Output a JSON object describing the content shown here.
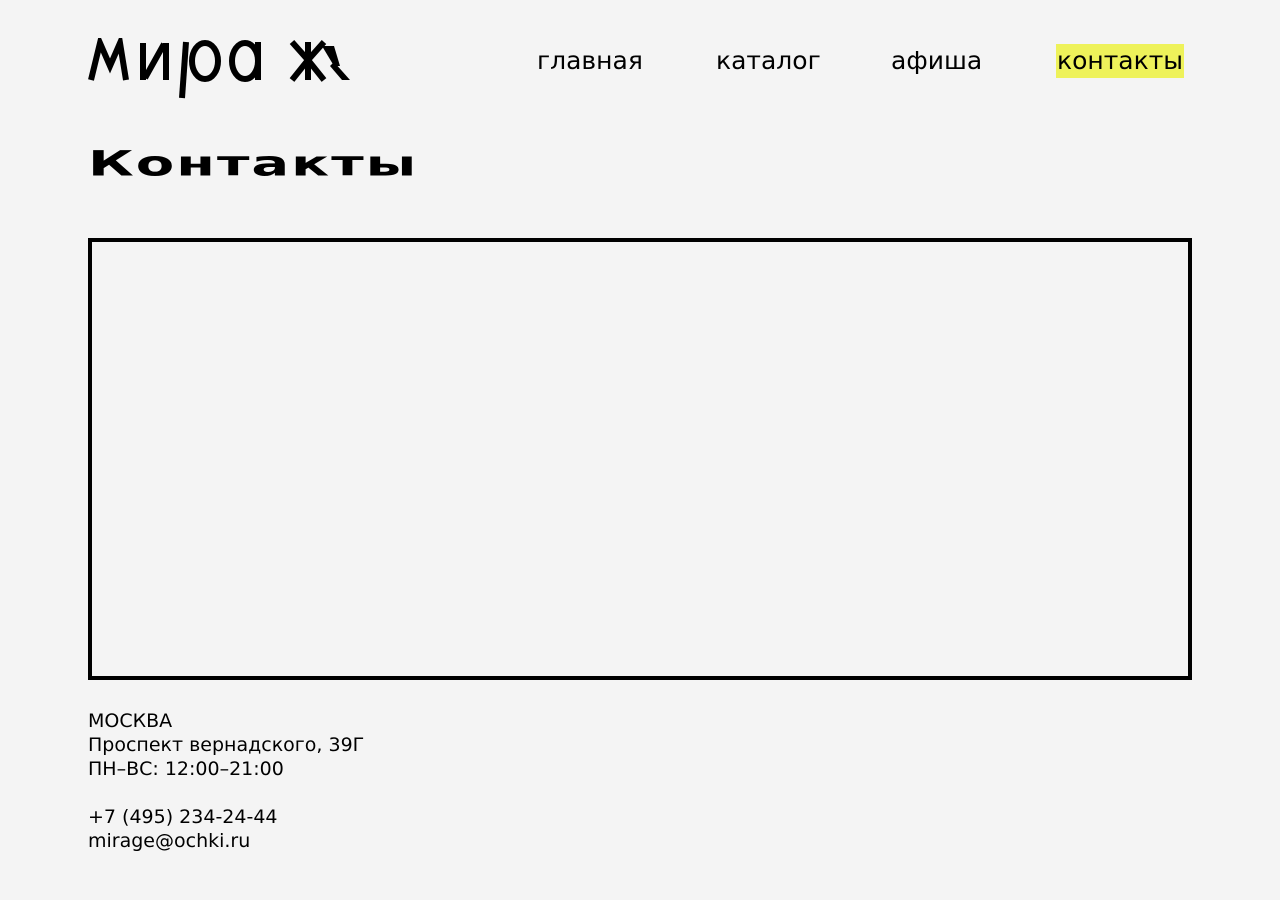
{
  "logo": {
    "alt": "мираж",
    "icon": "mirage-wordmark-logo"
  },
  "nav": {
    "items": [
      {
        "label": "главная",
        "active": false
      },
      {
        "label": "каталог",
        "active": false
      },
      {
        "label": "афиша",
        "active": false
      },
      {
        "label": "контакты",
        "active": true
      }
    ]
  },
  "page": {
    "title": "Контакты"
  },
  "contacts": {
    "city": "МОСКВА",
    "address": "Проспект вернадского, 39Г",
    "hours": "ПН–ВС: 12:00–21:00",
    "phone": "+7 (495) 234-24-44",
    "email": "mirage@ochki.ru"
  },
  "colors": {
    "background": "#f4f4f4",
    "text": "#000000",
    "active_highlight": "#eef25a"
  }
}
